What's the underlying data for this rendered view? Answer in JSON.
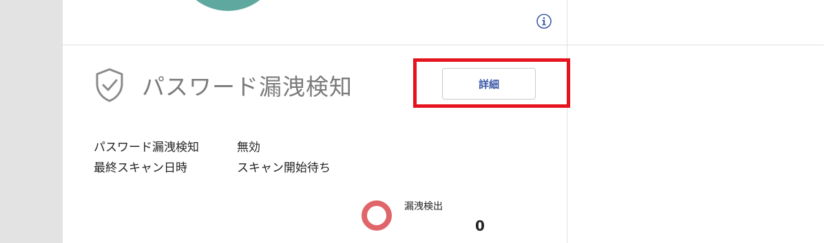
{
  "section": {
    "title": "パスワード漏洩検知",
    "details_button": "詳細"
  },
  "info_rows": [
    {
      "label": "パスワード漏洩検知",
      "value": "無効"
    },
    {
      "label": "最終スキャン日時",
      "value": "スキャン開始待ち"
    }
  ],
  "stat": {
    "label": "漏洩検出",
    "value": "0"
  },
  "colors": {
    "teal": "#5ea8a0",
    "ring": "#e0656a",
    "button_text": "#3b5aa6",
    "highlight": "#e5131d",
    "gutter": "#e3e3e3",
    "info_icon": "#3b5aa6"
  },
  "icons": [
    "info-icon",
    "shield-check-icon"
  ]
}
